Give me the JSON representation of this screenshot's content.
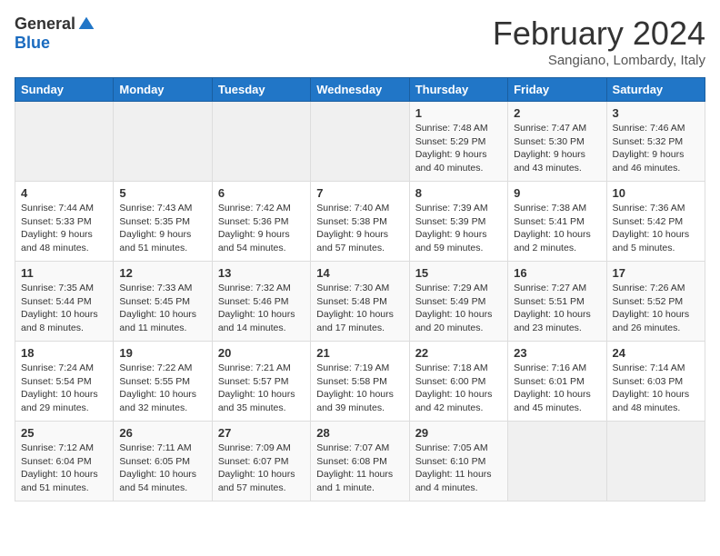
{
  "logo": {
    "general": "General",
    "blue": "Blue"
  },
  "header": {
    "title": "February 2024",
    "subtitle": "Sangiano, Lombardy, Italy"
  },
  "weekdays": [
    "Sunday",
    "Monday",
    "Tuesday",
    "Wednesday",
    "Thursday",
    "Friday",
    "Saturday"
  ],
  "weeks": [
    [
      {
        "day": "",
        "info": ""
      },
      {
        "day": "",
        "info": ""
      },
      {
        "day": "",
        "info": ""
      },
      {
        "day": "",
        "info": ""
      },
      {
        "day": "1",
        "info": "Sunrise: 7:48 AM\nSunset: 5:29 PM\nDaylight: 9 hours\nand 40 minutes."
      },
      {
        "day": "2",
        "info": "Sunrise: 7:47 AM\nSunset: 5:30 PM\nDaylight: 9 hours\nand 43 minutes."
      },
      {
        "day": "3",
        "info": "Sunrise: 7:46 AM\nSunset: 5:32 PM\nDaylight: 9 hours\nand 46 minutes."
      }
    ],
    [
      {
        "day": "4",
        "info": "Sunrise: 7:44 AM\nSunset: 5:33 PM\nDaylight: 9 hours\nand 48 minutes."
      },
      {
        "day": "5",
        "info": "Sunrise: 7:43 AM\nSunset: 5:35 PM\nDaylight: 9 hours\nand 51 minutes."
      },
      {
        "day": "6",
        "info": "Sunrise: 7:42 AM\nSunset: 5:36 PM\nDaylight: 9 hours\nand 54 minutes."
      },
      {
        "day": "7",
        "info": "Sunrise: 7:40 AM\nSunset: 5:38 PM\nDaylight: 9 hours\nand 57 minutes."
      },
      {
        "day": "8",
        "info": "Sunrise: 7:39 AM\nSunset: 5:39 PM\nDaylight: 9 hours\nand 59 minutes."
      },
      {
        "day": "9",
        "info": "Sunrise: 7:38 AM\nSunset: 5:41 PM\nDaylight: 10 hours\nand 2 minutes."
      },
      {
        "day": "10",
        "info": "Sunrise: 7:36 AM\nSunset: 5:42 PM\nDaylight: 10 hours\nand 5 minutes."
      }
    ],
    [
      {
        "day": "11",
        "info": "Sunrise: 7:35 AM\nSunset: 5:44 PM\nDaylight: 10 hours\nand 8 minutes."
      },
      {
        "day": "12",
        "info": "Sunrise: 7:33 AM\nSunset: 5:45 PM\nDaylight: 10 hours\nand 11 minutes."
      },
      {
        "day": "13",
        "info": "Sunrise: 7:32 AM\nSunset: 5:46 PM\nDaylight: 10 hours\nand 14 minutes."
      },
      {
        "day": "14",
        "info": "Sunrise: 7:30 AM\nSunset: 5:48 PM\nDaylight: 10 hours\nand 17 minutes."
      },
      {
        "day": "15",
        "info": "Sunrise: 7:29 AM\nSunset: 5:49 PM\nDaylight: 10 hours\nand 20 minutes."
      },
      {
        "day": "16",
        "info": "Sunrise: 7:27 AM\nSunset: 5:51 PM\nDaylight: 10 hours\nand 23 minutes."
      },
      {
        "day": "17",
        "info": "Sunrise: 7:26 AM\nSunset: 5:52 PM\nDaylight: 10 hours\nand 26 minutes."
      }
    ],
    [
      {
        "day": "18",
        "info": "Sunrise: 7:24 AM\nSunset: 5:54 PM\nDaylight: 10 hours\nand 29 minutes."
      },
      {
        "day": "19",
        "info": "Sunrise: 7:22 AM\nSunset: 5:55 PM\nDaylight: 10 hours\nand 32 minutes."
      },
      {
        "day": "20",
        "info": "Sunrise: 7:21 AM\nSunset: 5:57 PM\nDaylight: 10 hours\nand 35 minutes."
      },
      {
        "day": "21",
        "info": "Sunrise: 7:19 AM\nSunset: 5:58 PM\nDaylight: 10 hours\nand 39 minutes."
      },
      {
        "day": "22",
        "info": "Sunrise: 7:18 AM\nSunset: 6:00 PM\nDaylight: 10 hours\nand 42 minutes."
      },
      {
        "day": "23",
        "info": "Sunrise: 7:16 AM\nSunset: 6:01 PM\nDaylight: 10 hours\nand 45 minutes."
      },
      {
        "day": "24",
        "info": "Sunrise: 7:14 AM\nSunset: 6:03 PM\nDaylight: 10 hours\nand 48 minutes."
      }
    ],
    [
      {
        "day": "25",
        "info": "Sunrise: 7:12 AM\nSunset: 6:04 PM\nDaylight: 10 hours\nand 51 minutes."
      },
      {
        "day": "26",
        "info": "Sunrise: 7:11 AM\nSunset: 6:05 PM\nDaylight: 10 hours\nand 54 minutes."
      },
      {
        "day": "27",
        "info": "Sunrise: 7:09 AM\nSunset: 6:07 PM\nDaylight: 10 hours\nand 57 minutes."
      },
      {
        "day": "28",
        "info": "Sunrise: 7:07 AM\nSunset: 6:08 PM\nDaylight: 11 hours\nand 1 minute."
      },
      {
        "day": "29",
        "info": "Sunrise: 7:05 AM\nSunset: 6:10 PM\nDaylight: 11 hours\nand 4 minutes."
      },
      {
        "day": "",
        "info": ""
      },
      {
        "day": "",
        "info": ""
      }
    ]
  ]
}
